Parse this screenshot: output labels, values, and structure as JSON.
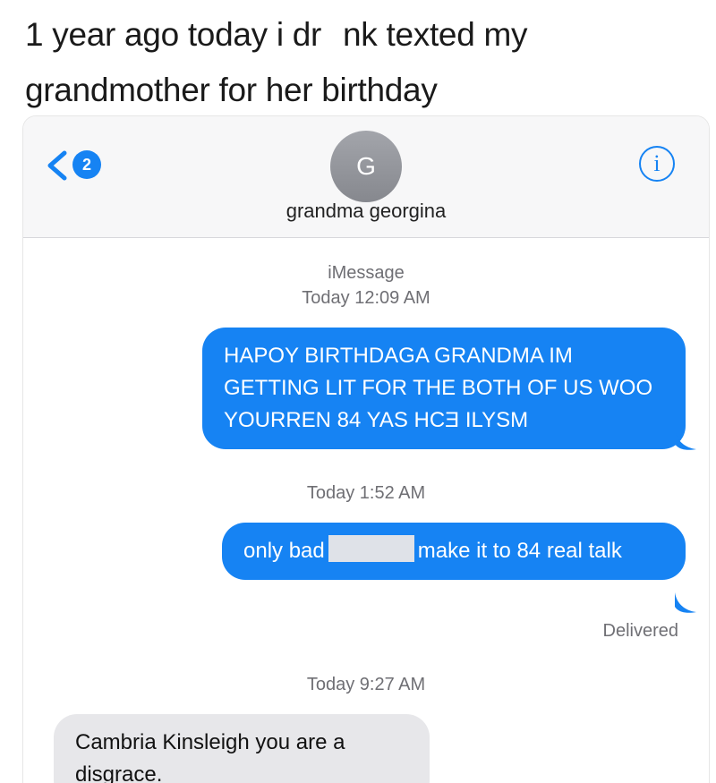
{
  "caption": {
    "line1_a": "1 year ago today i dr",
    "line1_b": "nk texted my",
    "line2": "grandmother for her birthday"
  },
  "header": {
    "back_badge": "2",
    "avatar_initial": "G",
    "contact_name": "grandma georgina",
    "info_icon": "i"
  },
  "thread": {
    "service": "iMessage",
    "timestamp_1": "Today 12:09 AM",
    "message_1": "HAPOY BIRTHDAGA GRANDMA IM GETTING LIT FOR THE BOTH OF US WOO YOURREN 84 YAS HCƎ ILYSM",
    "timestamp_2": "Today 1:52 AM",
    "message_2_a": "only bad",
    "message_2_b": "make it to 84 real talk",
    "status": "Delivered",
    "timestamp_3": "Today 9:27 AM",
    "message_3": "Cambria Kinsleigh you are a disgrace."
  },
  "colors": {
    "sent_bubble": "#1683f3",
    "received_bubble": "#e7e7ea",
    "ios_blue": "#1683f3"
  }
}
